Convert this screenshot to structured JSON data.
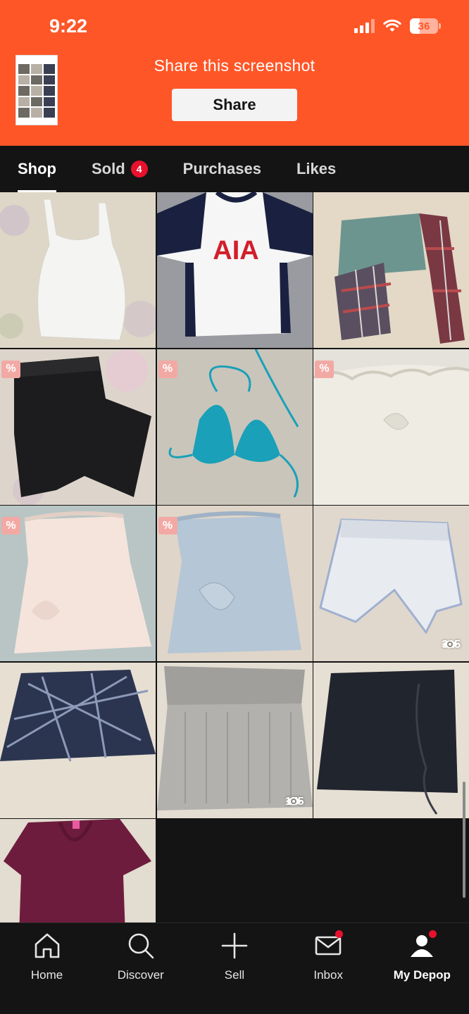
{
  "status_bar": {
    "time": "9:22",
    "battery": "36"
  },
  "share_banner": {
    "title": "Share this screenshot",
    "button": "Share"
  },
  "tabs": [
    {
      "label": "Shop",
      "active": true
    },
    {
      "label": "Sold",
      "badge": "4"
    },
    {
      "label": "Purchases"
    },
    {
      "label": "Likes"
    }
  ],
  "listings": [
    {
      "name": "white cami top",
      "discount": false,
      "views": null
    },
    {
      "name": "white football shirt",
      "print": "AIA",
      "discount": false,
      "views": null
    },
    {
      "name": "teal tee and plaid pants",
      "discount": false,
      "views": null
    },
    {
      "name": "black trousers",
      "discount": true,
      "discount_label": "%",
      "views": null
    },
    {
      "name": "blue bikini top",
      "discount": true,
      "discount_label": "%",
      "views": null
    },
    {
      "name": "cream ruffle top",
      "discount": true,
      "discount_label": "%",
      "views": null
    },
    {
      "name": "pale pink top",
      "discount": true,
      "discount_label": "%",
      "views": null
    },
    {
      "name": "light blue top",
      "discount": true,
      "discount_label": "%",
      "views": null
    },
    {
      "name": "white shorts",
      "discount": false,
      "views": "315"
    },
    {
      "name": "navy plaid skirt",
      "discount": false,
      "views": null
    },
    {
      "name": "grey knit top",
      "discount": false,
      "views": "175"
    },
    {
      "name": "black ruched skirt",
      "discount": false,
      "views": null
    },
    {
      "name": "burgundy tee",
      "discount": false,
      "views": null
    }
  ],
  "bottom_nav": [
    {
      "label": "Home",
      "icon": "home-icon"
    },
    {
      "label": "Discover",
      "icon": "search-icon"
    },
    {
      "label": "Sell",
      "icon": "plus-icon"
    },
    {
      "label": "Inbox",
      "icon": "mail-icon",
      "dot": true
    },
    {
      "label": "My Depop",
      "icon": "profile-icon",
      "dot": true,
      "active": true
    }
  ],
  "colors": {
    "brand": "#ff5627",
    "badge": "#e8112d",
    "discount_tag": "#f2a9a4"
  }
}
